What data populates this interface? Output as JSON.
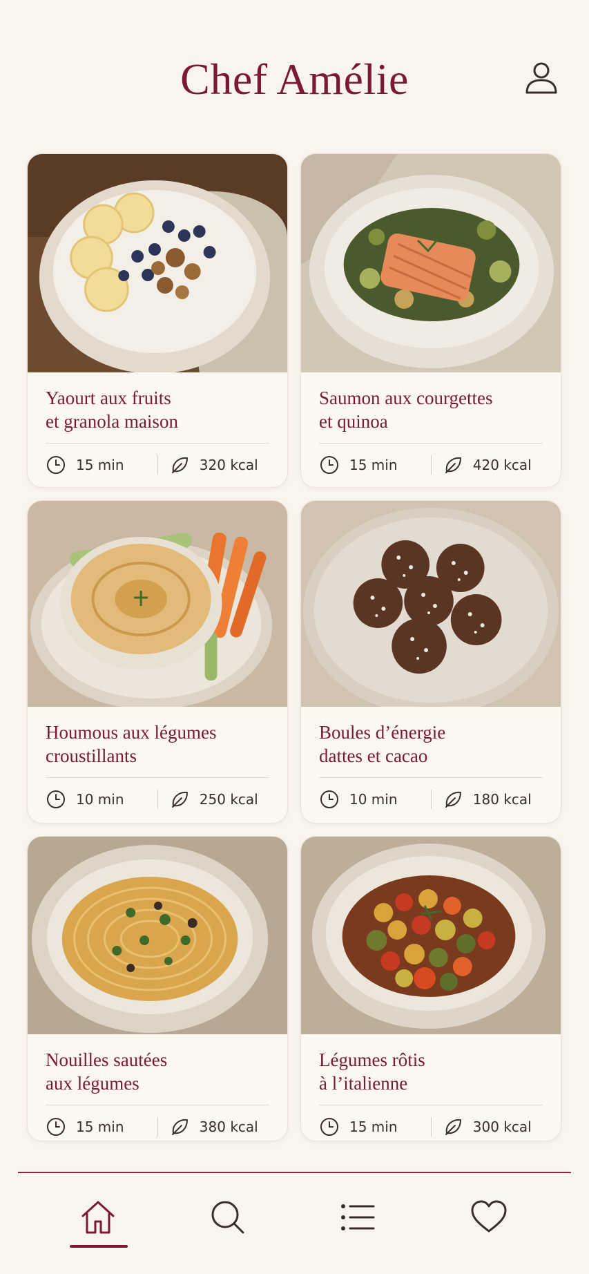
{
  "app": {
    "title": "Chef Amélie"
  },
  "colors": {
    "accent": "#7a1a30",
    "background": "#f9f4ee",
    "text": "#3a2d2d"
  },
  "recipes": [
    {
      "title": "Yaourt aux fruits\net granola maison",
      "time": "15 min",
      "calories": "320 kcal",
      "photo": "yogurt-bowl"
    },
    {
      "title": "Saumon aux courgettes\net quinoa",
      "time": "15 min",
      "calories": "420 kcal",
      "photo": "salmon-plate"
    },
    {
      "title": "Houmous aux légumes\ncroustillants",
      "time": "10 min",
      "calories": "250 kcal",
      "photo": "hummus-plate"
    },
    {
      "title": "Boules d’énergie\ndattes et cacao",
      "time": "10 min",
      "calories": "180 kcal",
      "photo": "energy-balls"
    },
    {
      "title": "Nouilles sautées\naux légumes",
      "time": "15 min",
      "calories": "380 kcal",
      "photo": "noodle-bowl"
    },
    {
      "title": "Légumes rôtis\nà l’italienne",
      "time": "15 min",
      "calories": "300 kcal",
      "photo": "roasted-vegetables"
    }
  ],
  "nav": {
    "items": [
      {
        "icon": "home-icon",
        "active": true
      },
      {
        "icon": "search-icon",
        "active": false
      },
      {
        "icon": "list-icon",
        "active": false
      },
      {
        "icon": "heart-icon",
        "active": false
      }
    ]
  }
}
